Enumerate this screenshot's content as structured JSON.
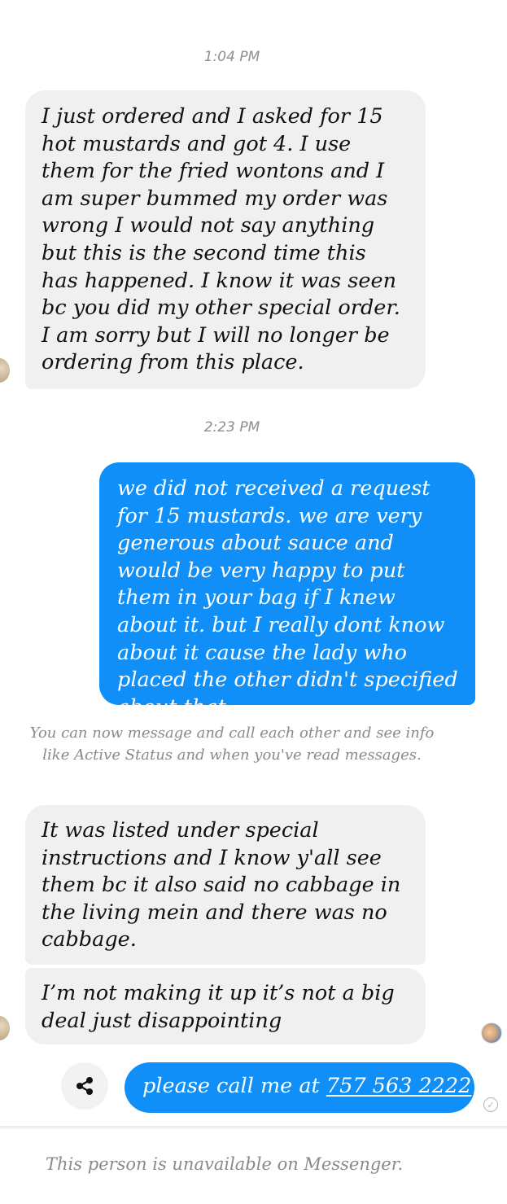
{
  "thread": [
    {
      "type": "timestamp",
      "text": "1:04 PM"
    },
    {
      "type": "incoming",
      "text": "I just ordered and I asked for 15 hot mustards and got 4. I use them for the fried wontons and I am super bummed my order was wrong I would not say anything but this is the second time this has happened. I know it was seen bc you did my other special order. I am sorry but I will no longer be ordering from this place."
    },
    {
      "type": "timestamp",
      "text": "2:23 PM"
    },
    {
      "type": "outgoing",
      "text": "we did not received a request for 15 mustards. we are very generous about sauce and would be very happy to put them in your bag if I knew about it. but I really dont know about it cause the lady who placed the other didn't specified about that."
    },
    {
      "type": "notice",
      "text": "You can now message and call each other and see info like Active Status and when you've read messages."
    },
    {
      "type": "incoming",
      "text": "It was listed under special instructions and I know y'all see them bc it also said no cabbage in the living mein and there was no cabbage."
    },
    {
      "type": "incoming",
      "text": "I’m not making it up it’s not a big deal just disappointing"
    },
    {
      "type": "outgoing",
      "prefix": "please call me at ",
      "phone": "757 563 2222"
    }
  ],
  "footer": {
    "text": "This person is unavailable on Messenger."
  },
  "icons": {
    "share": "share-icon",
    "seen": "seen-avatar",
    "sent": "sent-check-icon"
  },
  "colors": {
    "outgoing_bubble": "#0f8ff7",
    "incoming_bubble": "#f0f0f0",
    "muted_text": "#8e8e93"
  }
}
